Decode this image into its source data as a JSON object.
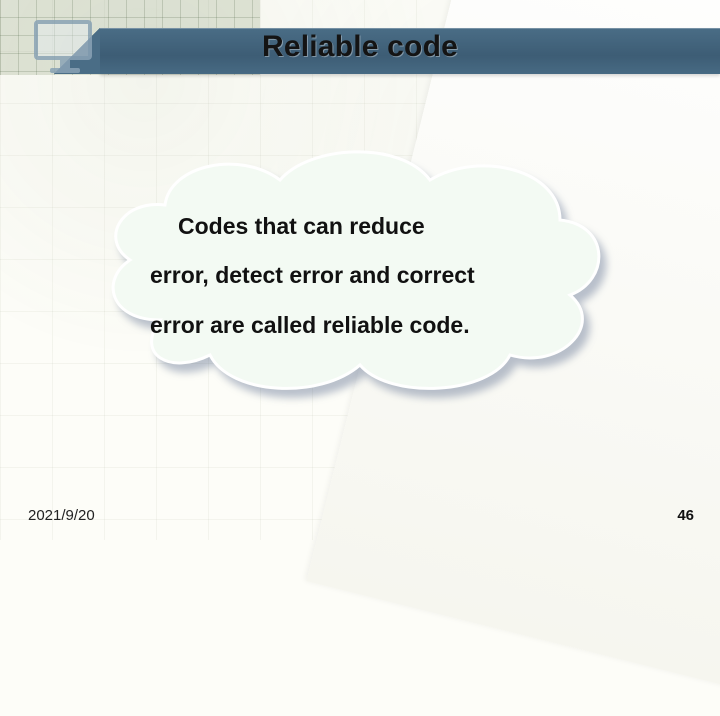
{
  "header": {
    "title": "Reliable code"
  },
  "cloud": {
    "line1": "Codes that can reduce",
    "line2": "error, detect error and correct",
    "line3": "error are called reliable code."
  },
  "footer": {
    "date": "2021/9/20",
    "page": "46"
  }
}
